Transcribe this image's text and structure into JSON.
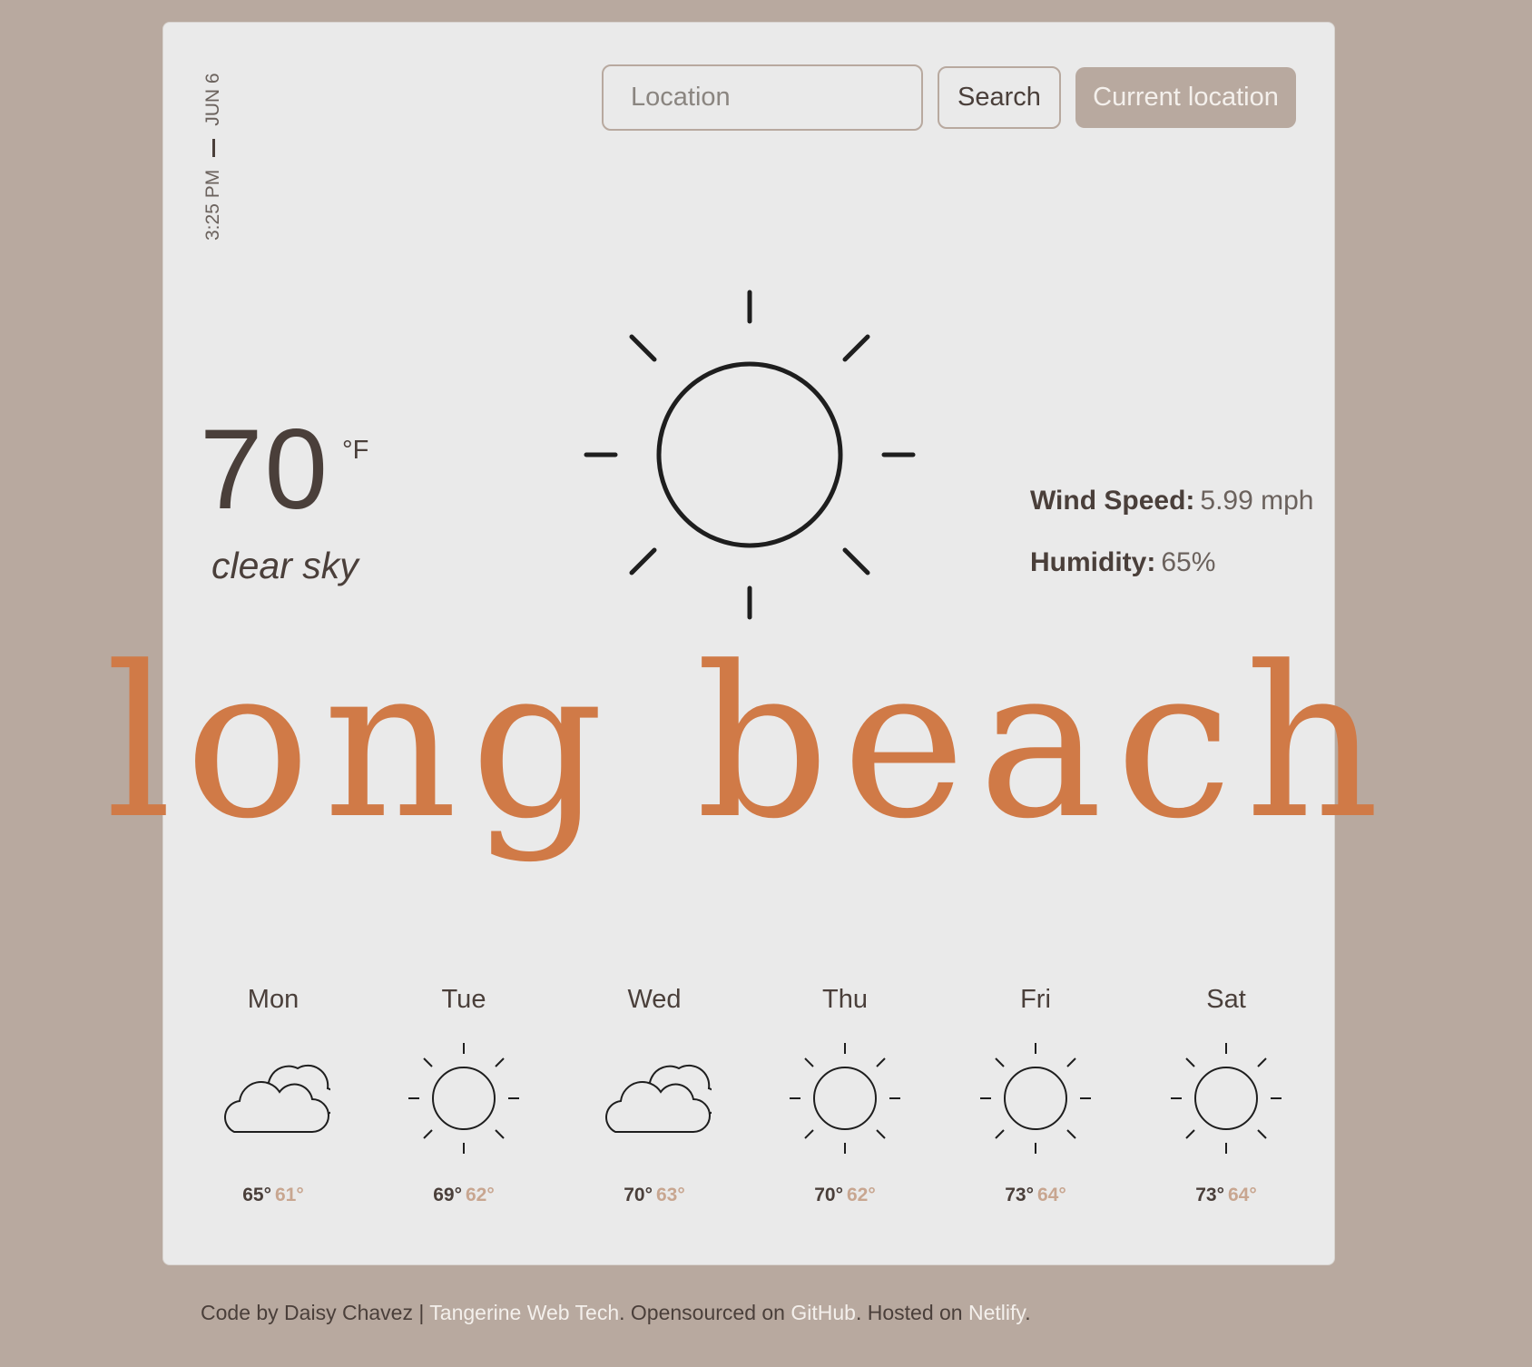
{
  "header": {
    "date": "JUN 6",
    "time": "3:25 PM",
    "search_placeholder": "Location",
    "search_button": "Search",
    "current_location_button": "Current location"
  },
  "current": {
    "temperature": "70",
    "unit": "°F",
    "description": "clear sky",
    "icon": "sun-icon",
    "wind_label": "Wind Speed:",
    "wind_value": "5.99 mph",
    "humidity_label": "Humidity:",
    "humidity_value": "65%",
    "city": "long beach"
  },
  "forecast": [
    {
      "day": "Mon",
      "icon": "clouds-icon",
      "high": "65°",
      "low": "61°"
    },
    {
      "day": "Tue",
      "icon": "sun-icon",
      "high": "69°",
      "low": "62°"
    },
    {
      "day": "Wed",
      "icon": "clouds-icon",
      "high": "70°",
      "low": "63°"
    },
    {
      "day": "Thu",
      "icon": "sun-icon",
      "high": "70°",
      "low": "62°"
    },
    {
      "day": "Fri",
      "icon": "sun-icon",
      "high": "73°",
      "low": "64°"
    },
    {
      "day": "Sat",
      "icon": "sun-icon",
      "high": "73°",
      "low": "64°"
    }
  ],
  "footer": {
    "prefix": "Code by Daisy Chavez | ",
    "link1": "Tangerine Web Tech",
    "mid1": ". Opensourced on ",
    "link2": "GitHub",
    "mid2": ". Hosted on ",
    "link3": "Netlify",
    "suffix": "."
  },
  "colors": {
    "background": "#b8a99f",
    "card": "#eaeaea",
    "accent": "#d07a47",
    "text": "#4a3f3a",
    "low_temp": "#c8a690"
  }
}
